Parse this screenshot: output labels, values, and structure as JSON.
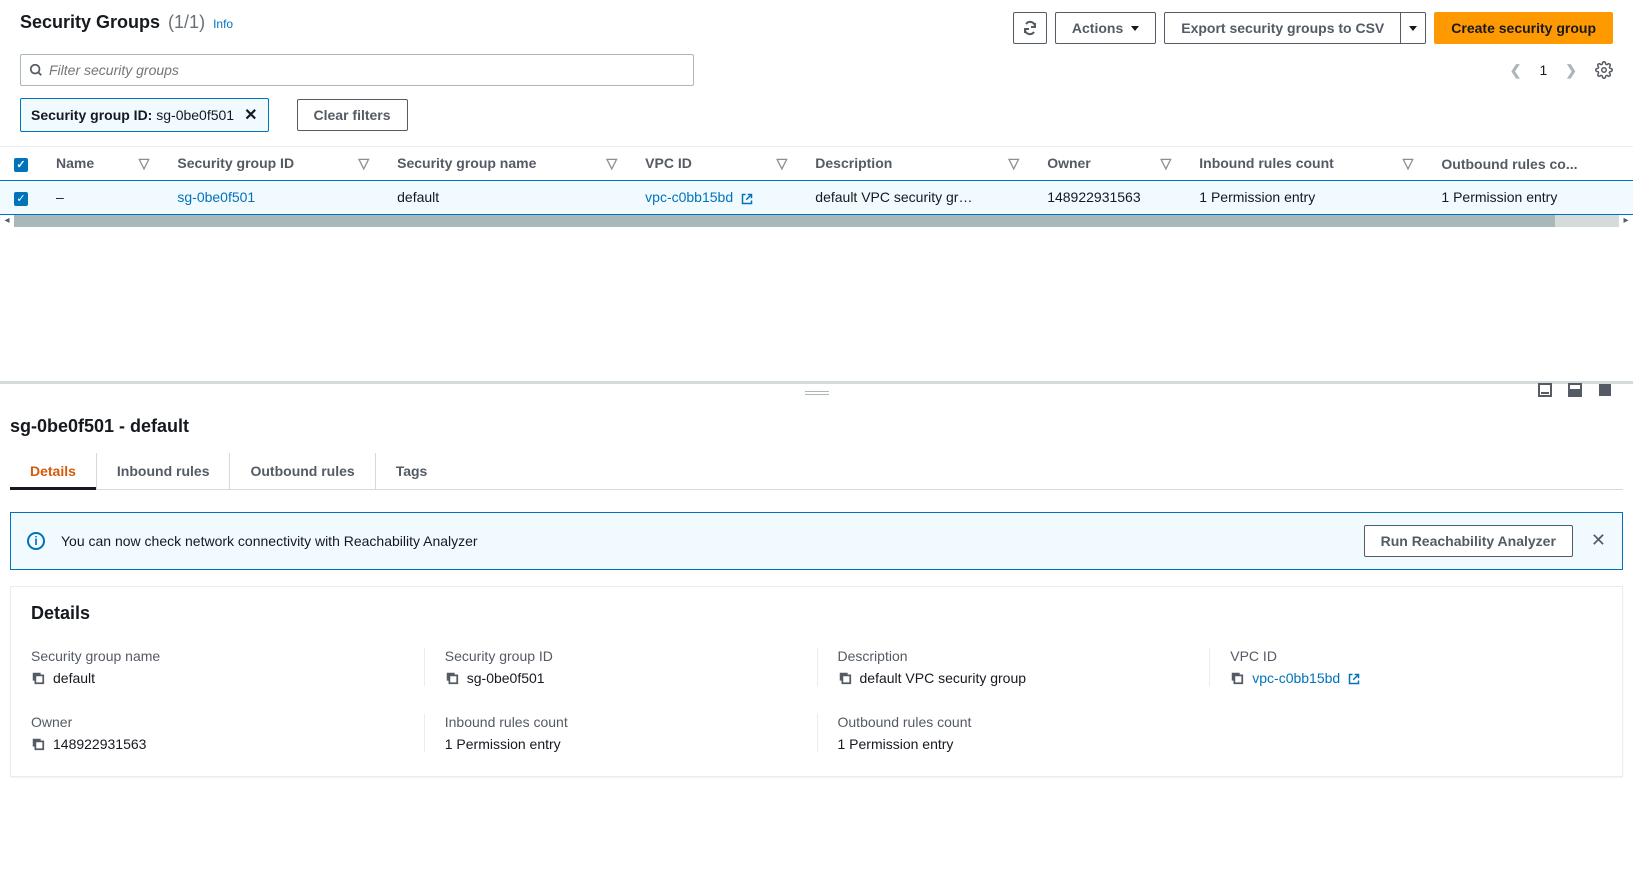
{
  "header": {
    "title": "Security Groups",
    "count": "(1/1)",
    "info": "Info",
    "actions": {
      "actions_label": "Actions",
      "export_label": "Export security groups to CSV",
      "create_label": "Create security group"
    }
  },
  "search": {
    "placeholder": "Filter security groups"
  },
  "filter_chip": {
    "label": "Security group ID:",
    "value": "sg-0be0f501"
  },
  "clear_filters": "Clear filters",
  "pagination": {
    "page": "1"
  },
  "table": {
    "columns": [
      "Name",
      "Security group ID",
      "Security group name",
      "VPC ID",
      "Description",
      "Owner",
      "Inbound rules count",
      "Outbound rules co..."
    ],
    "row": {
      "name": "–",
      "sg_id": "sg-0be0f501",
      "sg_name": "default",
      "vpc_id": "vpc-c0bb15bd",
      "description": "default VPC security gr…",
      "owner": "148922931563",
      "inbound": "1 Permission entry",
      "outbound": "1 Permission entry"
    }
  },
  "detail": {
    "heading": "sg-0be0f501 - default",
    "tabs": [
      "Details",
      "Inbound rules",
      "Outbound rules",
      "Tags"
    ],
    "alert": {
      "text": "You can now check network connectivity with Reachability Analyzer",
      "action": "Run Reachability Analyzer"
    },
    "card_title": "Details",
    "fields": {
      "sg_name_label": "Security group name",
      "sg_name": "default",
      "sg_id_label": "Security group ID",
      "sg_id": "sg-0be0f501",
      "desc_label": "Description",
      "desc": "default VPC security group",
      "vpc_label": "VPC ID",
      "vpc": "vpc-c0bb15bd",
      "owner_label": "Owner",
      "owner": "148922931563",
      "in_label": "Inbound rules count",
      "in": "1 Permission entry",
      "out_label": "Outbound rules count",
      "out": "1 Permission entry"
    }
  }
}
